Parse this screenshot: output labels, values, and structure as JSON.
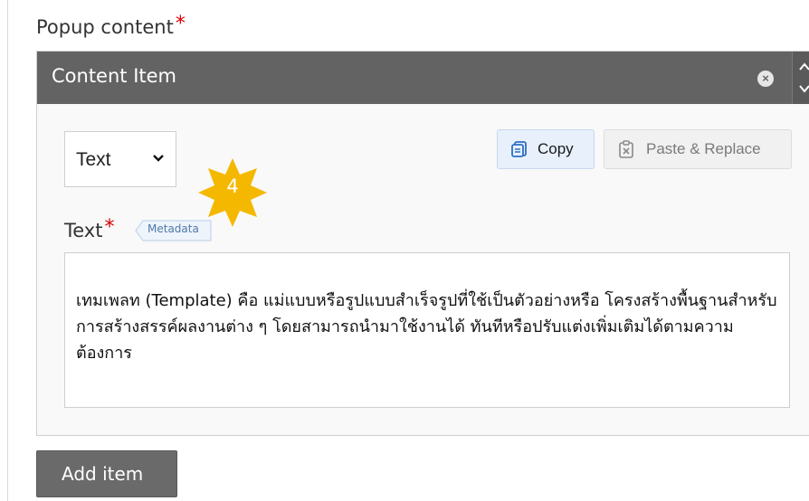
{
  "field": {
    "label": "Popup content",
    "required_mark": "*"
  },
  "content_item": {
    "title": "Content Item",
    "remove_icon": "×",
    "type_select": {
      "value": "Text"
    },
    "copy_button": {
      "label": "Copy"
    },
    "paste_button": {
      "label": "Paste & Replace"
    },
    "badge": {
      "number": "4",
      "color": "#f5b800"
    },
    "text_field": {
      "label": "Text",
      "required_mark": "*",
      "metadata_tag": "Metadata",
      "value": "เทมเพลท (Template) คือ แม่แบบหรือรูปแบบสำเร็จรูปที่ใช้เป็นตัวอย่างหรือ โครงสร้างพื้นฐานสำหรับการสร้างสรรค์ผลงานต่าง ๆ โดยสามารถนำมาใช้งานได้ ทันทีหรือปรับแต่งเพิ่มเติมได้ตามความต้องการ"
    }
  },
  "add_button": {
    "label": "Add item"
  },
  "colors": {
    "header_bg": "#636363",
    "required": "#d80000",
    "copy_bg": "#e7f0fb",
    "add_bg": "#6a6a6a"
  }
}
